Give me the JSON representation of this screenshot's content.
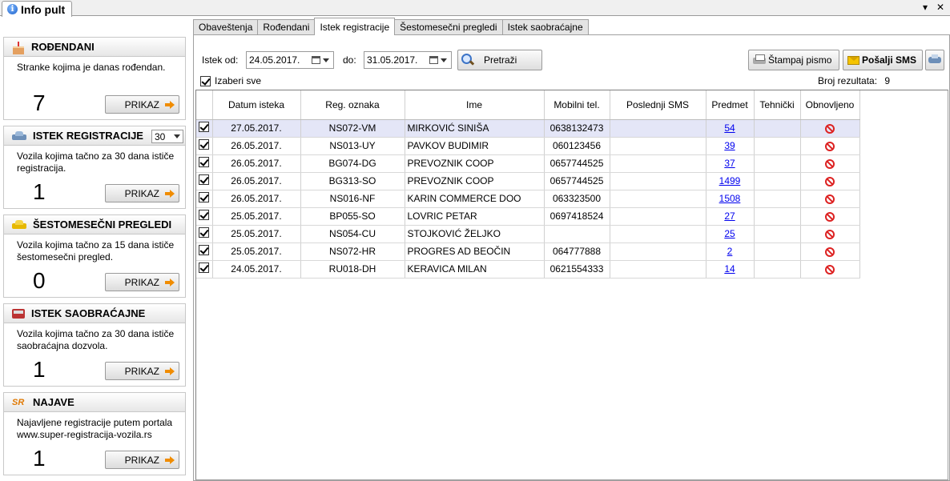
{
  "window": {
    "tab_title": "Info pult",
    "minimize_glyph": "▾",
    "close_glyph": "✕"
  },
  "cards": [
    {
      "title": "ROĐENDANI",
      "icon": "cake-icon",
      "desc": "Stranke kojima je danas rođendan.",
      "count": "7",
      "button": "PRIKAZ"
    },
    {
      "title": "ISTEK REGISTRACIJE",
      "icon": "car-icon",
      "select_value": "30",
      "desc": "Vozila kojima tačno za 30 dana ističe registracija.",
      "count": "1",
      "button": "PRIKAZ"
    },
    {
      "title": "ŠESTOMESEČNI PREGLEDI",
      "icon": "taxi-icon",
      "desc": "Vozila kojima tačno za 15 dana ističe šestomesečni pregled.",
      "count": "0",
      "button": "PRIKAZ"
    },
    {
      "title": "ISTEK SAOBRAĆAJNE",
      "icon": "bus-icon",
      "desc": "Vozila kojima tačno za 30 dana ističe saobraćajna dozvola.",
      "count": "1",
      "button": "PRIKAZ"
    },
    {
      "title": "NAJAVE",
      "icon": "sr-logo-icon",
      "icon_text": "SR",
      "desc": "Najavljene registracije putem portala www.super-registracija-vozila.rs",
      "count": "1",
      "button": "PRIKAZ"
    }
  ],
  "subtabs": [
    "Obaveštenja",
    "Rođendani",
    "Istek registracije",
    "Šestomesečni pregledi",
    "Istek saobraćajne"
  ],
  "active_subtab": "Istek registracije",
  "filter": {
    "from_label": "Istek od:",
    "from_value": "24.05.2017.",
    "to_label": "do:",
    "to_value": "31.05.2017.",
    "search_button": "Pretraži",
    "print_button": "Štampaj pismo",
    "sms_button": "Pošalji SMS",
    "select_all_label": "Izaberi sve",
    "result_label": "Broj rezultata:",
    "result_count": "9"
  },
  "table": {
    "headers": [
      "Datum isteka",
      "Reg. oznaka",
      "Ime",
      "Mobilni tel.",
      "Poslednji SMS",
      "Predmet",
      "Tehnički",
      "Obnovljeno"
    ],
    "rows": [
      {
        "date": "27.05.2017.",
        "reg": "NS072-VM",
        "name": "MIRKOVIĆ SINIŠA",
        "phone": "0638132473",
        "sms": "",
        "predmet": "54",
        "tech": ""
      },
      {
        "date": "26.05.2017.",
        "reg": "NS013-UY",
        "name": "PAVKOV BUDIMIR",
        "phone": "060123456",
        "sms": "",
        "predmet": "39",
        "tech": ""
      },
      {
        "date": "26.05.2017.",
        "reg": "BG074-DG",
        "name": "PREVOZNIK COOP",
        "phone": "0657744525",
        "sms": "",
        "predmet": "37",
        "tech": ""
      },
      {
        "date": "26.05.2017.",
        "reg": "BG313-SO",
        "name": "PREVOZNIK COOP",
        "phone": "0657744525",
        "sms": "",
        "predmet": "1499",
        "tech": ""
      },
      {
        "date": "26.05.2017.",
        "reg": "NS016-NF",
        "name": "KARIN COMMERCE DOO",
        "phone": "063323500",
        "sms": "",
        "predmet": "1508",
        "tech": ""
      },
      {
        "date": "25.05.2017.",
        "reg": "BP055-SO",
        "name": "LOVRIC PETAR",
        "phone": "0697418524",
        "sms": "",
        "predmet": "27",
        "tech": ""
      },
      {
        "date": "25.05.2017.",
        "reg": "NS054-CU",
        "name": "STOJKOVIĆ ŽELJKO",
        "phone": "",
        "sms": "",
        "predmet": "25",
        "tech": ""
      },
      {
        "date": "25.05.2017.",
        "reg": "NS072-HR",
        "name": "PROGRES AD BEOČIN",
        "phone": "064777888",
        "sms": "",
        "predmet": "2",
        "tech": ""
      },
      {
        "date": "24.05.2017.",
        "reg": "RU018-DH",
        "name": "KERAVICA MILAN",
        "phone": "0621554333",
        "sms": "",
        "predmet": "14",
        "tech": ""
      }
    ]
  }
}
